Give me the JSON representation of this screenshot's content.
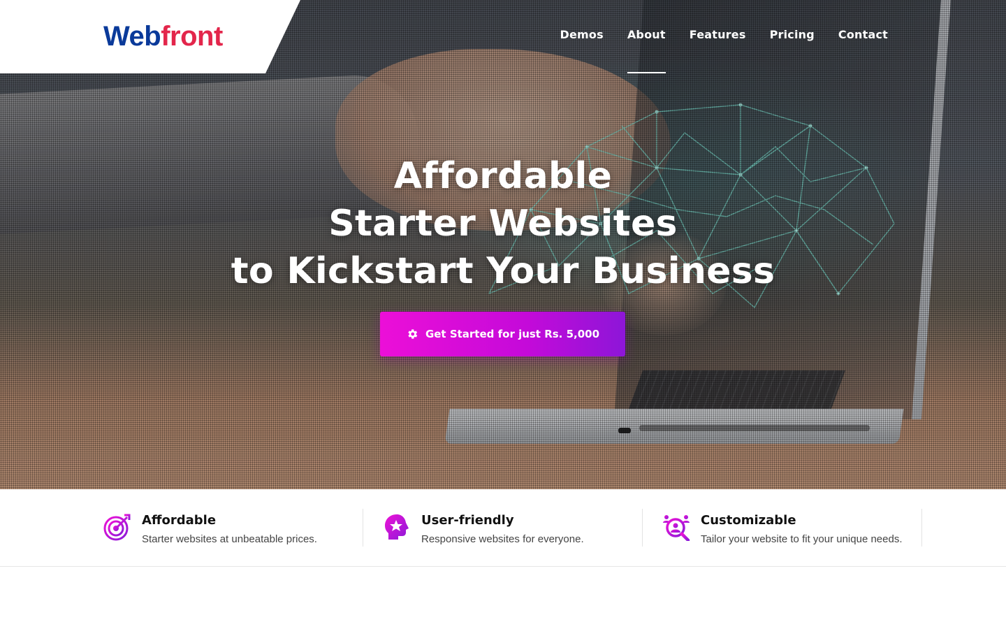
{
  "brand": {
    "logo_part1": "Web",
    "logo_part2": "front",
    "colors": {
      "blue": "#0a3a9a",
      "red": "#e3264b",
      "accent_start": "#ec0fd8",
      "accent_end": "#8d16d8"
    }
  },
  "nav": {
    "items": [
      {
        "label": "Demos",
        "active": false
      },
      {
        "label": "About",
        "active": true
      },
      {
        "label": "Features",
        "active": false
      },
      {
        "label": "Pricing",
        "active": false
      },
      {
        "label": "Contact",
        "active": false
      }
    ]
  },
  "hero": {
    "line1": "Affordable",
    "line2": "Starter Websites",
    "line3": "to Kickstart Your Business",
    "cta_label": "Get Started for just Rs. 5,000",
    "cta_icon": "gear-icon"
  },
  "features": [
    {
      "title": "Affordable",
      "description": "Starter websites at unbeatable prices.",
      "icon": "target-icon"
    },
    {
      "title": "User-friendly",
      "description": "Responsive websites for everyone.",
      "icon": "head-star-icon"
    },
    {
      "title": "Customizable",
      "description": "Tailor your website to fit your unique needs.",
      "icon": "search-person-icon"
    }
  ]
}
